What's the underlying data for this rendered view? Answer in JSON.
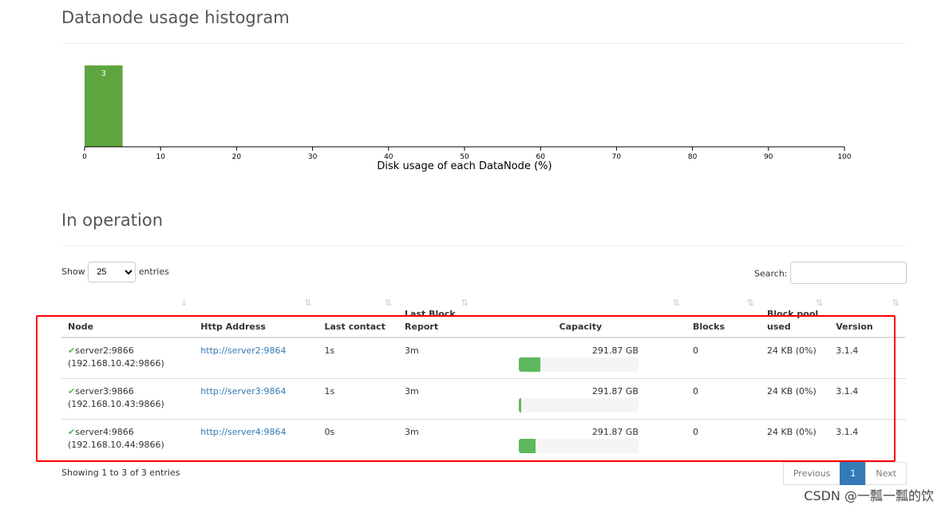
{
  "histogram": {
    "title": "Datanode usage histogram"
  },
  "chart_data": {
    "type": "bar",
    "xlabel": "Disk usage of each DataNode (%)",
    "xlim": [
      0,
      100
    ],
    "xticks": [
      0,
      10,
      20,
      30,
      40,
      50,
      60,
      70,
      80,
      90,
      100
    ],
    "bins": [
      {
        "from": 0,
        "to": 5,
        "count": 3
      }
    ],
    "color": "#5fa53f"
  },
  "operation": {
    "title": "In operation",
    "show_label": "Show",
    "entries_label": "entries",
    "page_size": "25",
    "search_label": "Search:",
    "search_value": ""
  },
  "table": {
    "columns": [
      "Node",
      "Http Address",
      "Last contact",
      "Last Block Report",
      "Capacity",
      "Blocks",
      "Block pool used",
      "Version"
    ],
    "rows": [
      {
        "node": "server2:9866",
        "ip": "(192.168.10.42:9866)",
        "http": "http://server2:9864",
        "contact": "1s",
        "report": "3m",
        "capacity": "291.87 GB",
        "usage_pct": 18,
        "blocks": "0",
        "pool": "24 KB (0%)",
        "version": "3.1.4"
      },
      {
        "node": "server3:9866",
        "ip": "(192.168.10.43:9866)",
        "http": "http://server3:9864",
        "contact": "1s",
        "report": "3m",
        "capacity": "291.87 GB",
        "usage_pct": 2,
        "blocks": "0",
        "pool": "24 KB (0%)",
        "version": "3.1.4"
      },
      {
        "node": "server4:9866",
        "ip": "(192.168.10.44:9866)",
        "http": "http://server4:9864",
        "contact": "0s",
        "report": "3m",
        "capacity": "291.87 GB",
        "usage_pct": 14,
        "blocks": "0",
        "pool": "24 KB (0%)",
        "version": "3.1.4"
      }
    ]
  },
  "footer": {
    "info": "Showing 1 to 3 of 3 entries",
    "previous": "Previous",
    "page": "1",
    "next": "Next"
  },
  "watermark": "CSDN @一瓢一瓢的饮"
}
